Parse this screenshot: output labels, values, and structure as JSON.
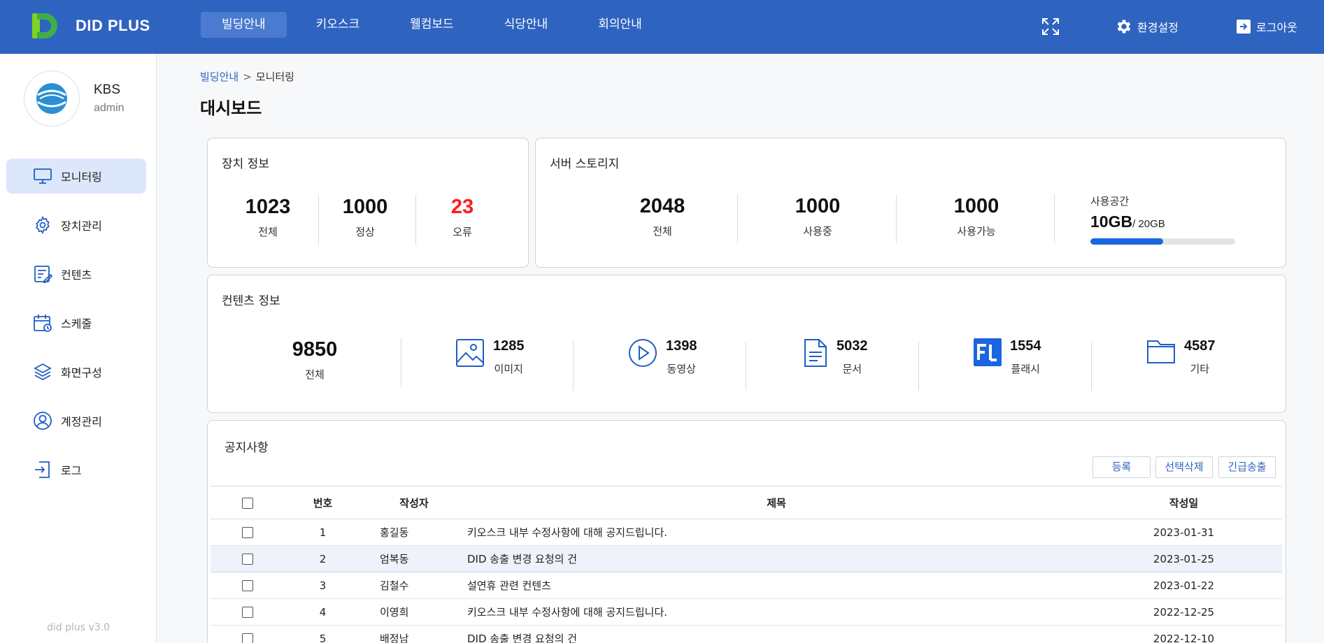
{
  "header": {
    "brand": "DID PLUS",
    "nav": [
      "빌딩안내",
      "키오스크",
      "웰컴보드",
      "식당안내",
      "회의안내"
    ],
    "settings": "환경설정",
    "logout": "로그아웃",
    "brand_color": "#2f63c0"
  },
  "sidebar": {
    "name": "KBS",
    "role": "admin",
    "items": [
      {
        "label": "모니터링",
        "icon": "monitor-icon"
      },
      {
        "label": "장치관리",
        "icon": "gear-icon"
      },
      {
        "label": "컨텐츠",
        "icon": "content-edit-icon"
      },
      {
        "label": "스케줄",
        "icon": "calendar-icon"
      },
      {
        "label": "화면구성",
        "icon": "layers-icon"
      },
      {
        "label": "계정관리",
        "icon": "user-circle-icon"
      },
      {
        "label": "로그",
        "icon": "log-in-icon"
      }
    ],
    "version": "did plus v3.0"
  },
  "breadcrumb": {
    "parent": "빌딩안내",
    "separator": ">",
    "current": "모니터링"
  },
  "page_title": "대시보드",
  "device": {
    "title": "장치 정보",
    "stats": [
      {
        "value": "1023",
        "label": "전체"
      },
      {
        "value": "1000",
        "label": "정상"
      },
      {
        "value": "23",
        "label": "오류",
        "color": "#ff1a1a"
      }
    ]
  },
  "storage": {
    "title": "서버 스토리지",
    "stats": [
      {
        "value": "2048",
        "label": "전체"
      },
      {
        "value": "1000",
        "label": "사용중"
      },
      {
        "value": "1000",
        "label": "사용가능"
      }
    ],
    "usage_label": "사용공간",
    "used": "10GB",
    "total": "/ 20GB",
    "used_fraction": 0.5
  },
  "contents": {
    "title": "컨텐츠 정보",
    "total": {
      "value": "9850",
      "label": "전체"
    },
    "items": [
      {
        "value": "1285",
        "label": "이미지",
        "icon": "image-icon"
      },
      {
        "value": "1398",
        "label": "동영상",
        "icon": "play-icon"
      },
      {
        "value": "5032",
        "label": "문서",
        "icon": "document-icon"
      },
      {
        "value": "1554",
        "label": "플래시",
        "icon": "flash-icon"
      },
      {
        "value": "4587",
        "label": "기타",
        "icon": "folder-icon"
      }
    ]
  },
  "notice": {
    "title": "공지사항",
    "buttons": {
      "register": "등록",
      "delete_selected": "선택삭제",
      "emergency": "긴급송출"
    },
    "columns": [
      "번호",
      "작성자",
      "제목",
      "작성일"
    ],
    "rows": [
      {
        "no": "1",
        "author": "홍길동",
        "title": "키오스크 내부 수정사항에 대해 공지드립니다.",
        "date": "2023-01-31"
      },
      {
        "no": "2",
        "author": "엄복동",
        "title": "DID 송출 변경 요청의 건",
        "date": "2023-01-25"
      },
      {
        "no": "3",
        "author": "김철수",
        "title": "설연휴 관련 컨텐츠",
        "date": "2023-01-22"
      },
      {
        "no": "4",
        "author": "이영희",
        "title": "키오스크 내부 수정사항에 대해 공지드립니다.",
        "date": "2022-12-25"
      },
      {
        "no": "5",
        "author": "배정남",
        "title": "DID 송출 변경 요청의 건",
        "date": "2022-12-10"
      }
    ]
  }
}
